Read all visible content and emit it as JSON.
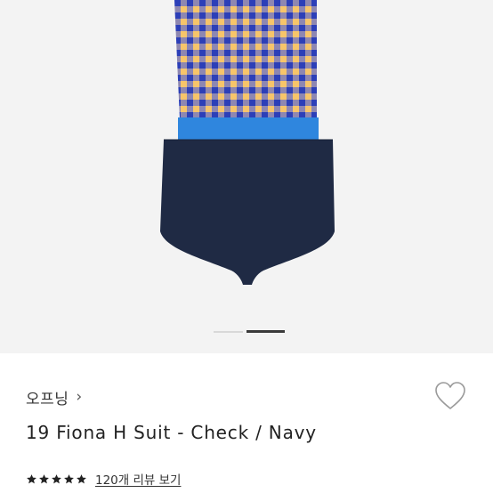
{
  "product": {
    "brand": "오프닝",
    "brand_chevron": "›",
    "title": "19 Fiona H Suit - Check / Navy",
    "rating_stars": 5,
    "reviews_link": "120개 리뷰 보기"
  },
  "gallery": {
    "image": "swimsuit-check-navy-icon",
    "total_slides": 2,
    "active_slide": 2,
    "colors": {
      "check_yellow": "#f7c56a",
      "check_blue": "#3f57c8",
      "waistband": "#2f86de",
      "navy": "#1f2a44",
      "background": "#f3f3f3"
    }
  },
  "icons": {
    "wishlist": "heart-outline-icon",
    "star": "star-filled-icon"
  }
}
